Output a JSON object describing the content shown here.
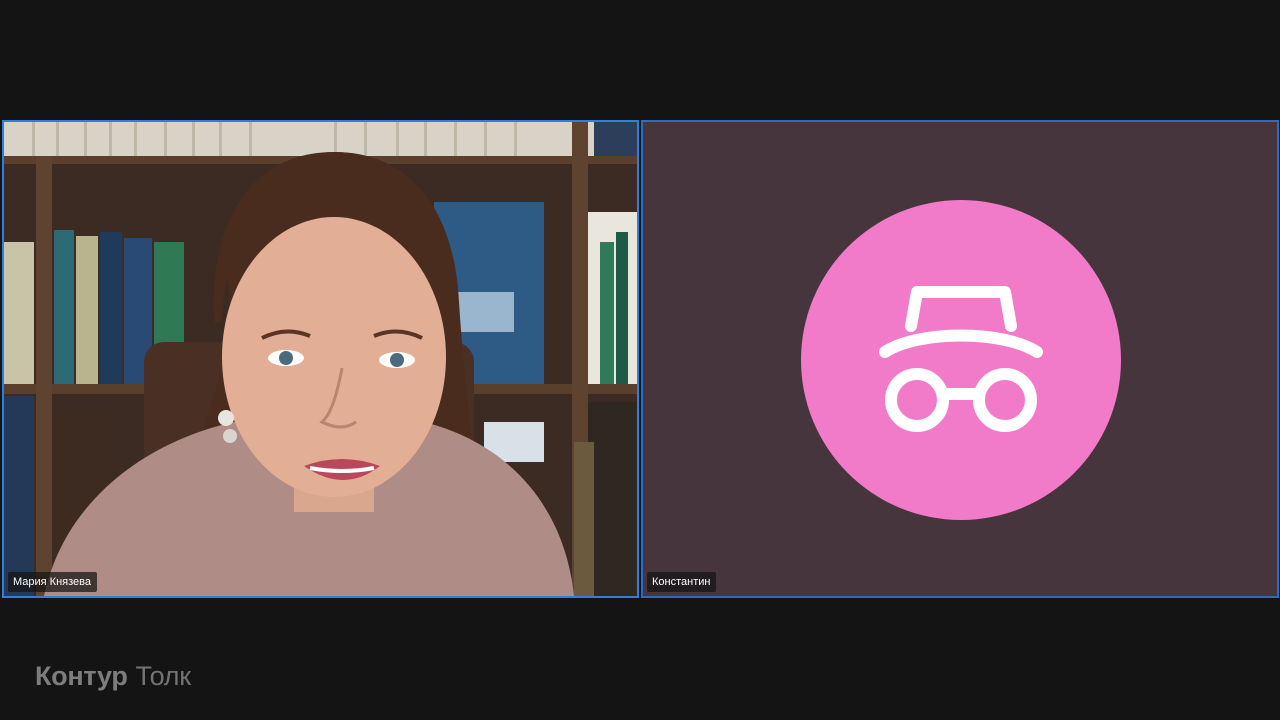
{
  "participants": [
    {
      "name": "Мария Князева",
      "video": "camera-on",
      "speaking": true
    },
    {
      "name": "Константин",
      "video": "camera-off",
      "avatar_icon": "incognito-icon",
      "avatar_color": "#f17bc8",
      "speaking": false
    }
  ],
  "brand": {
    "primary": "Контур",
    "secondary": "Толк"
  },
  "colors": {
    "background": "#141414",
    "active_border": "#2f7fe0",
    "avatar_tile_bg": "#47353e",
    "avatar_circle": "#f17bc8"
  }
}
